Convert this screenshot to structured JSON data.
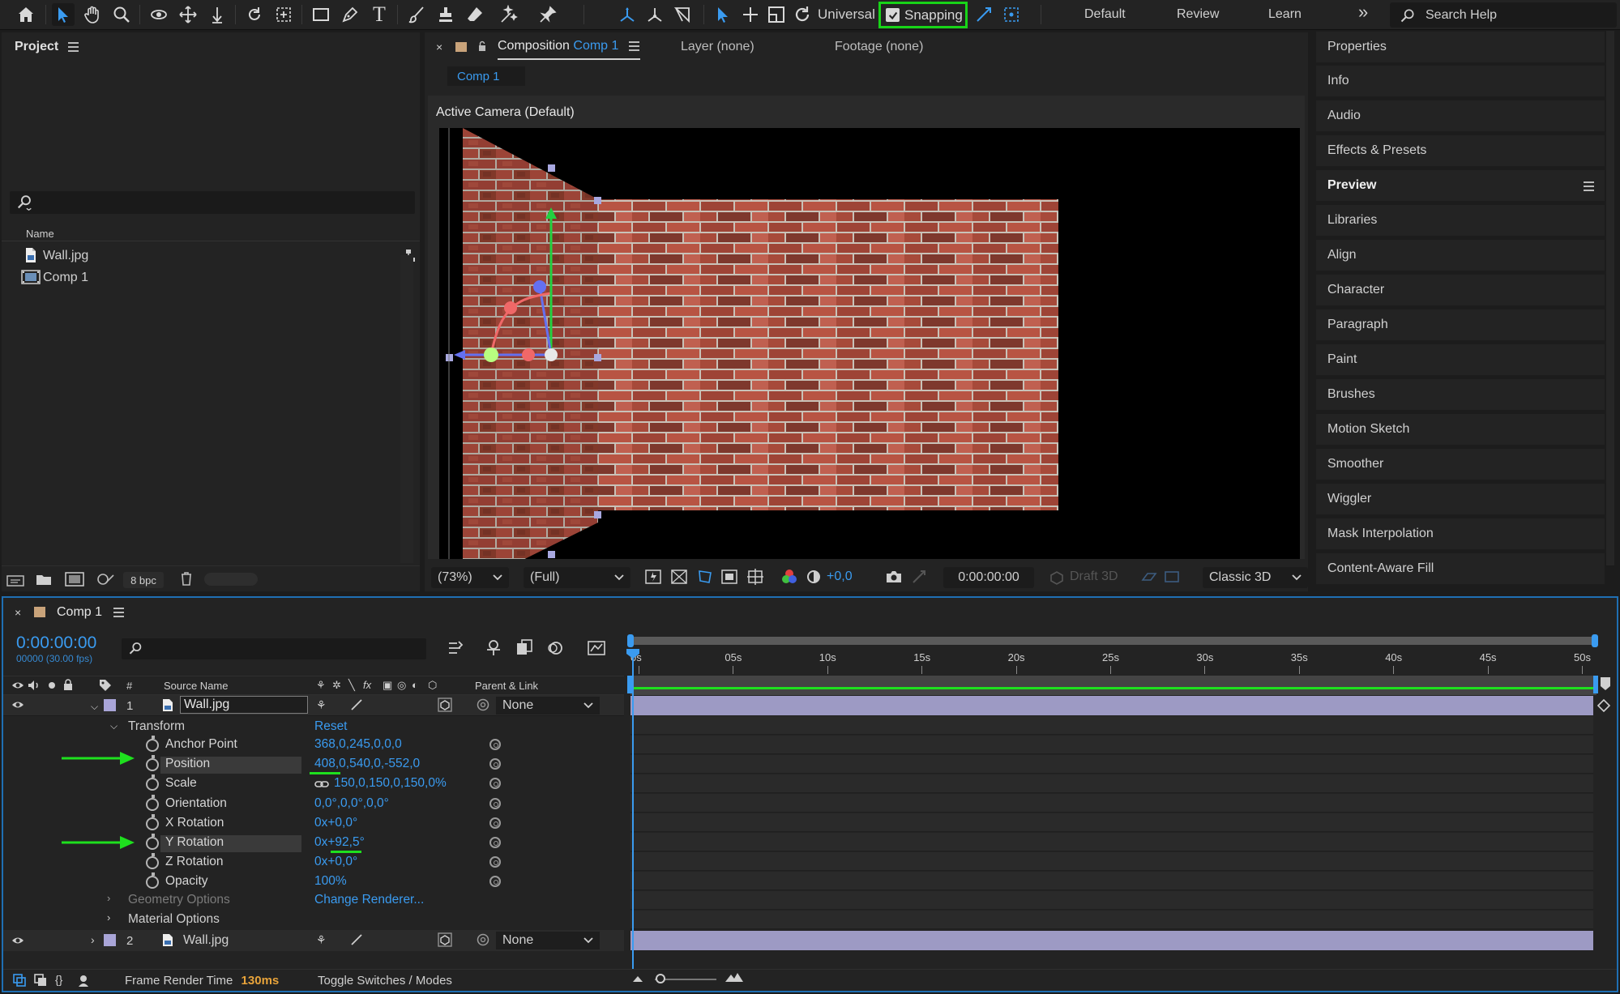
{
  "toolbar": {
    "universal_label": "Universal",
    "snapping_label": "Snapping",
    "snapping_checked": true,
    "workspaces": [
      "Default",
      "Review",
      "Learn"
    ],
    "overflow_label": "»",
    "search_placeholder": "Search Help"
  },
  "project": {
    "title": "Project",
    "column_name": "Name",
    "items": [
      {
        "name": "Wall.jpg",
        "icon": "file-image-icon"
      },
      {
        "name": "Comp 1",
        "icon": "composition-icon"
      }
    ],
    "bpc": "8 bpc"
  },
  "viewer": {
    "tab_prefix": "Composition",
    "tab_comp": "Comp 1",
    "layer_tab": "Layer (none)",
    "footage_tab": "Footage (none)",
    "breadcrumb": "Comp 1",
    "camera_label": "Active Camera (Default)",
    "zoom": "(73%)",
    "resolution": "(Full)",
    "exposure": "+0,0",
    "timecode": "0:00:00:00",
    "draft3d": "Draft 3D",
    "renderer": "Classic 3D"
  },
  "right_panel": {
    "items": [
      "Properties",
      "Info",
      "Audio",
      "Effects & Presets",
      "Preview",
      "Libraries",
      "Align",
      "Character",
      "Paragraph",
      "Paint",
      "Brushes",
      "Motion Sketch",
      "Smoother",
      "Wiggler",
      "Mask Interpolation",
      "Content-Aware Fill"
    ]
  },
  "timeline": {
    "tab": "Comp 1",
    "timecode": "0:00:00:00",
    "fps": "00000 (30.00 fps)",
    "col_num": "#",
    "col_source": "Source Name",
    "col_parent": "Parent & Link",
    "layers": [
      {
        "num": "1",
        "name": "Wall.jpg",
        "parent": "None"
      },
      {
        "num": "2",
        "name": "Wall.jpg",
        "parent": "None"
      }
    ],
    "transform_label": "Transform",
    "reset_label": "Reset",
    "properties": [
      {
        "name": "Anchor Point",
        "value": "368,0,245,0,0,0"
      },
      {
        "name": "Position",
        "value": "408,0,540,0,-552,0"
      },
      {
        "name": "Scale",
        "value": "150,0,150,0,150,0%"
      },
      {
        "name": "Orientation",
        "value": "0,0°,0,0°,0,0°"
      },
      {
        "name": "X Rotation",
        "prefix": "0x",
        "value": "+0,0°"
      },
      {
        "name": "Y Rotation",
        "prefix": "0x",
        "value": "+92,5°"
      },
      {
        "name": "Z Rotation",
        "prefix": "0x",
        "value": "+0,0°"
      },
      {
        "name": "Opacity",
        "value": "100%"
      }
    ],
    "geometry_label": "Geometry Options",
    "change_renderer": "Change Renderer...",
    "material_label": "Material Options",
    "ruler": [
      "0s",
      "05s",
      "10s",
      "15s",
      "20s",
      "25s",
      "30s",
      "35s",
      "40s",
      "45s",
      "50s"
    ],
    "frame_render_label": "Frame Render Time",
    "frame_render_value": "130ms",
    "toggle_label": "Toggle Switches / Modes"
  },
  "colors": {
    "accent": "#3a9bf0",
    "highlight": "#1ee01e",
    "render_time": "#e8a33a"
  }
}
